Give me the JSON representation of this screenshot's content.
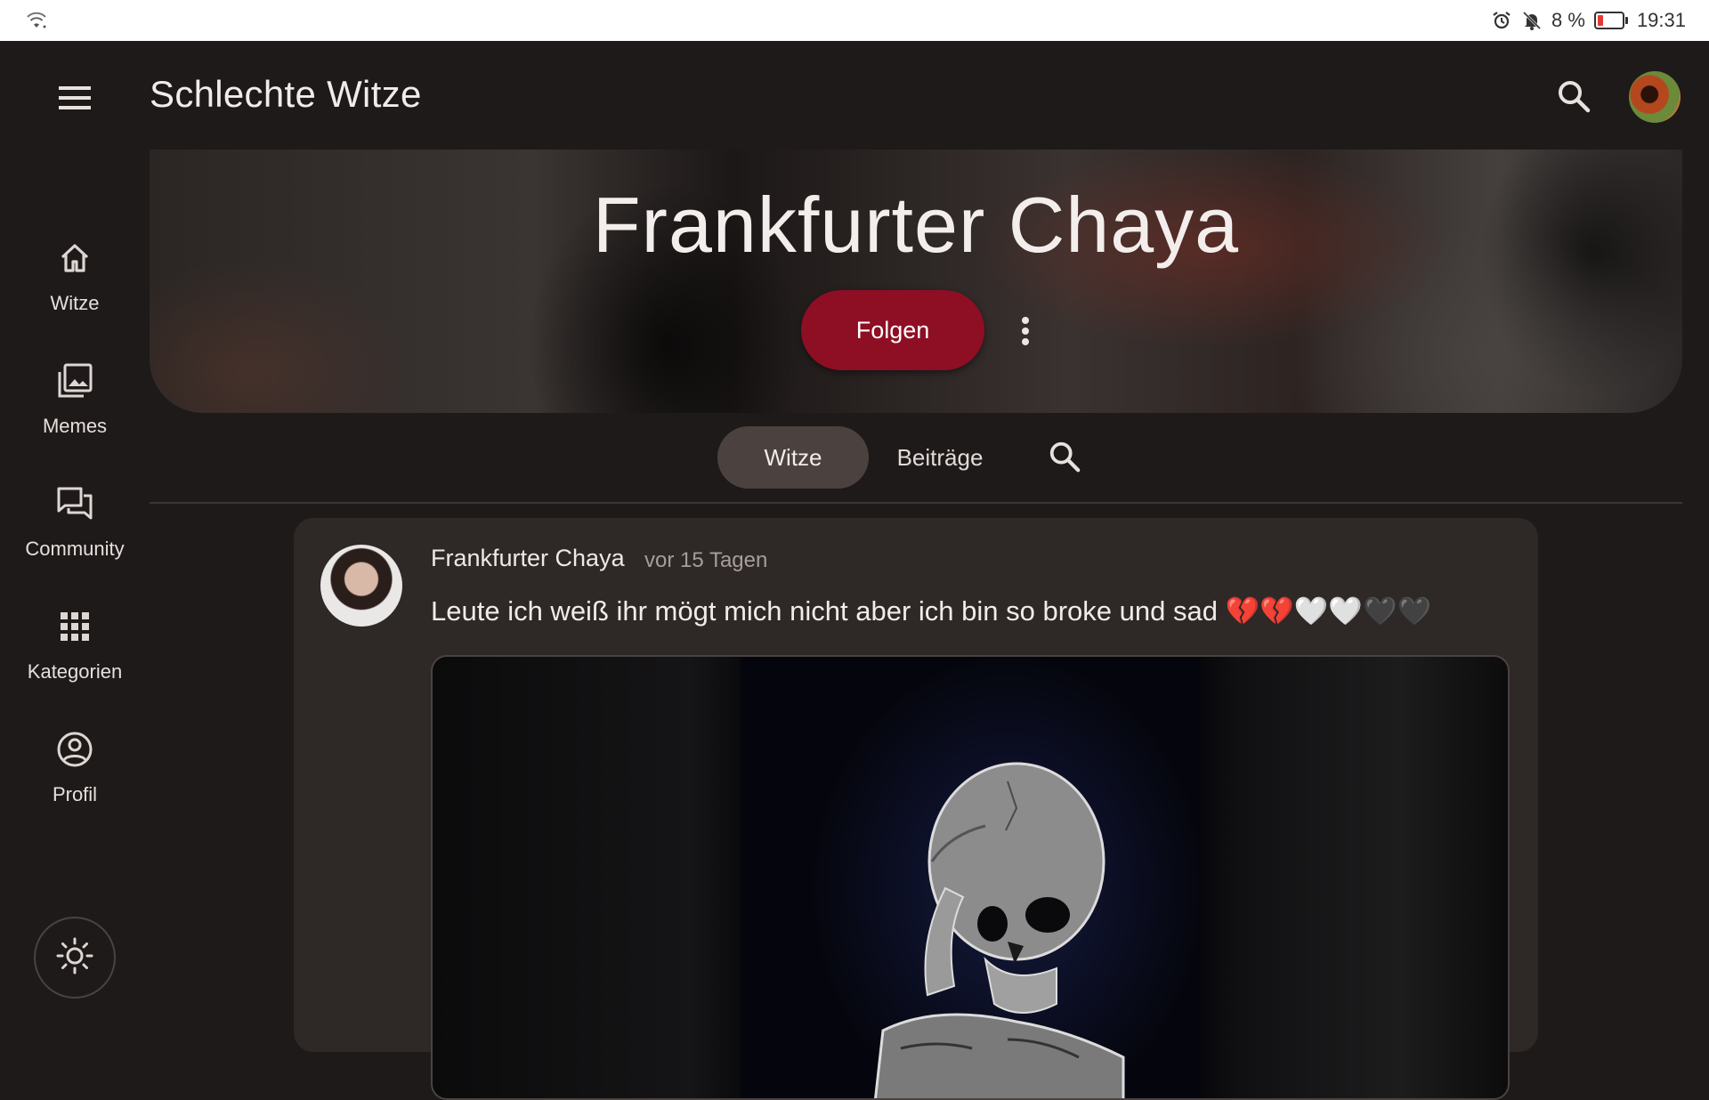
{
  "status_bar": {
    "battery": "8 %",
    "time": "19:31"
  },
  "app": {
    "title": "Schlechte Witze"
  },
  "rail": {
    "items": [
      {
        "label": "Witze",
        "icon": "home-icon"
      },
      {
        "label": "Memes",
        "icon": "image-library-icon"
      },
      {
        "label": "Community",
        "icon": "forum-icon"
      },
      {
        "label": "Kategorien",
        "icon": "grid-icon"
      },
      {
        "label": "Profil",
        "icon": "account-circle-icon"
      }
    ]
  },
  "banner": {
    "title": "Frankfurter Chaya",
    "follow_label": "Folgen"
  },
  "tabs": {
    "items": [
      {
        "label": "Witze",
        "selected": true
      },
      {
        "label": "Beiträge",
        "selected": false
      }
    ]
  },
  "post": {
    "author": "Frankfurter Chaya",
    "time": "vor 15 Tagen",
    "text": "Leute ich weiß ihr mögt mich nicht aber ich bin so broke und sad 💔💔🤍🤍🖤🖤"
  },
  "colors": {
    "accent": "#8e0e24",
    "background": "#1e1a19",
    "card": "#2e2827",
    "tab_selected": "#4b4240"
  }
}
